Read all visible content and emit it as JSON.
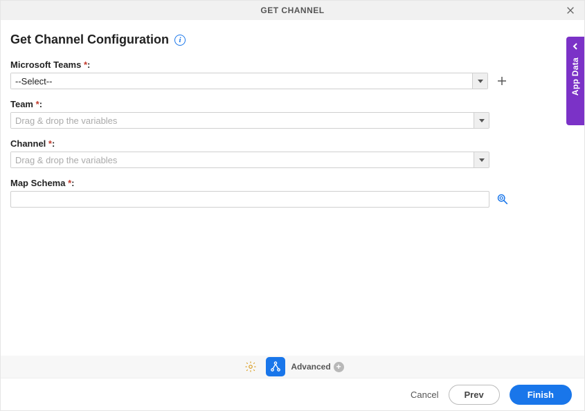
{
  "titlebar": {
    "title": "GET CHANNEL"
  },
  "page_head": {
    "title": "Get Channel Configuration"
  },
  "fields": {
    "ms_teams": {
      "label": "Microsoft Teams",
      "required_marker": "*",
      "selected": "--Select--"
    },
    "team": {
      "label": "Team",
      "required_marker": "*",
      "placeholder": "Drag & drop the variables"
    },
    "channel": {
      "label": "Channel",
      "required_marker": "*",
      "placeholder": "Drag & drop the variables"
    },
    "map_schema": {
      "label": "Map Schema",
      "required_marker": "*",
      "value": ""
    }
  },
  "sidebar": {
    "label": "App Data"
  },
  "footer_toolbar": {
    "advanced_label": "Advanced"
  },
  "footer_buttons": {
    "cancel": "Cancel",
    "prev": "Prev",
    "finish": "Finish"
  }
}
